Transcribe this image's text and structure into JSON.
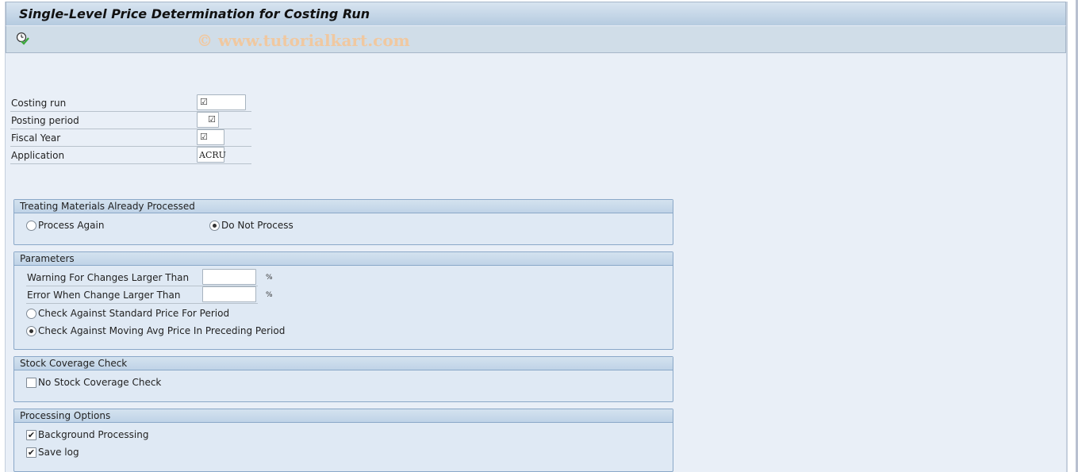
{
  "window": {
    "title": "Single-Level Price Determination for Costing Run",
    "watermark": "© www.tutorialkart.com"
  },
  "toolbar": {
    "execute_icon": "execute-clock-check-icon"
  },
  "fields": [
    {
      "label": "Costing run",
      "value": "☑",
      "required": true
    },
    {
      "label": "Posting period",
      "value": "☑",
      "required": true
    },
    {
      "label": "Fiscal Year",
      "value": "☑",
      "required": true
    },
    {
      "label": "Application",
      "value": "ACRU",
      "required": false
    }
  ],
  "groups": {
    "treating": {
      "title": "Treating Materials Already Processed",
      "options": [
        {
          "label": "Process Again",
          "selected": false
        },
        {
          "label": "Do Not Process",
          "selected": true
        }
      ]
    },
    "parameters": {
      "title": "Parameters",
      "fields": [
        {
          "label": "Warning For Changes Larger Than",
          "value": "",
          "unit": "%"
        },
        {
          "label": "Error When Change Larger Than",
          "value": "",
          "unit": "%"
        }
      ],
      "options": [
        {
          "label": "Check Against Standard Price For Period",
          "selected": false
        },
        {
          "label": "Check Against Moving Avg Price In Preceding Period",
          "selected": true
        }
      ]
    },
    "stock": {
      "title": "Stock Coverage Check",
      "checks": [
        {
          "label": "No Stock Coverage Check",
          "checked": false
        }
      ]
    },
    "processing": {
      "title": "Processing Options",
      "checks": [
        {
          "label": "Background Processing",
          "checked": true
        },
        {
          "label": "Save log",
          "checked": true
        }
      ]
    }
  }
}
